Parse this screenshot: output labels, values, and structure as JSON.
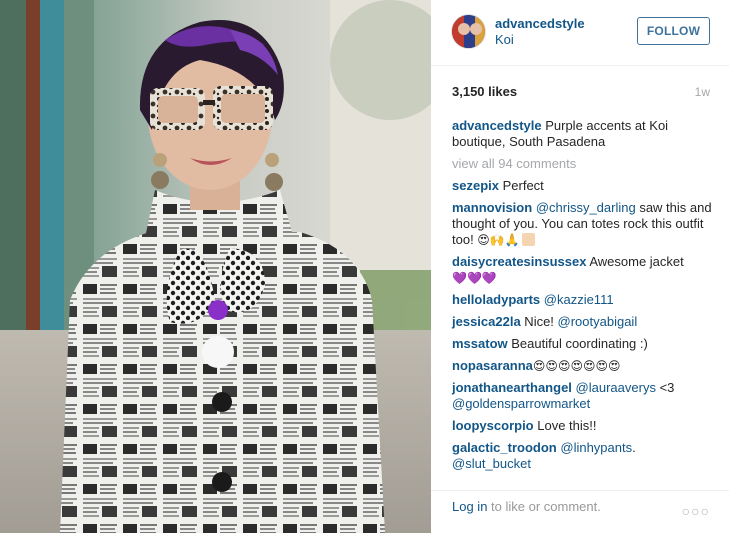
{
  "post": {
    "username": "advancedstyle",
    "location": "Koi",
    "follow_label": "FOLLOW",
    "likes": "3,150 likes",
    "time": "1w",
    "caption_user": "advancedstyle",
    "caption_text": " Purple accents at Koi boutique, South Pasadena",
    "view_all": "view all 94 comments"
  },
  "comments": [
    {
      "user": "sezepix",
      "text": " Perfect"
    },
    {
      "user": "mannovision",
      "mention": "@chrissy_darling",
      "text": " saw this and thought of you. You can totes rock this outfit too! ",
      "emoji": "😍🙌🙏"
    },
    {
      "user": "daisycreatesinsussex",
      "text": " Awesome jacket ",
      "emoji": "💜💜💜"
    },
    {
      "user": "helloladyparts",
      "mention": "@kazzie111"
    },
    {
      "user": "jessica22la",
      "text": " Nice! ",
      "mention2": "@rootyabigail"
    },
    {
      "user": "mssatow",
      "text": " Beautiful coordinating :)"
    },
    {
      "user": "nopasaranna",
      "emoji": " 😍😍😍😍😍😍😍"
    },
    {
      "user": "jonathanearthangel",
      "mention": "@lauraaverys",
      "text": " <3",
      "mention2": "@goldensparrowmarket"
    },
    {
      "user": "loopyscorpio",
      "text": " Love this!!"
    },
    {
      "user": "galactic_troodon",
      "mention": "@linhypants",
      "text": ".",
      "mention2": "@slut_bucket"
    }
  ],
  "footer": {
    "login_link": "Log in",
    "login_text": " to like or comment.",
    "more": "○○○"
  },
  "colors": {
    "link": "#125688",
    "follow": "#3f729b",
    "muted": "#a5a7aa",
    "hair_purple": "#5b2a8f"
  },
  "icons": [
    "more-options-icon"
  ]
}
